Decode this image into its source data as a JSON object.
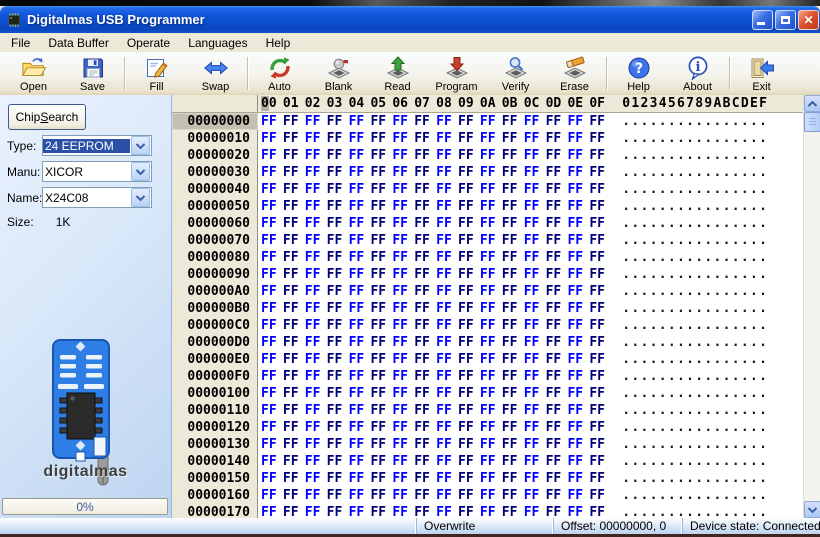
{
  "window": {
    "title": "Digitalmas USB Programmer",
    "controls": {
      "minimize": "minimize",
      "maximize": "maximize",
      "close": "✕"
    }
  },
  "menu_bar": {
    "items": [
      "File",
      "Data Buffer",
      "Operate",
      "Languages",
      "Help"
    ]
  },
  "toolbar": {
    "buttons": [
      {
        "label": "Open",
        "icon": "open-folder-icon",
        "group_end": false
      },
      {
        "label": "Save",
        "icon": "save-floppy-icon",
        "group_end": true
      },
      {
        "label": "Fill",
        "icon": "fill-edit-icon",
        "group_end": false
      },
      {
        "label": "Swap",
        "icon": "swap-arrows-icon",
        "group_end": true
      },
      {
        "label": "Auto",
        "icon": "auto-cycle-icon",
        "group_end": false
      },
      {
        "label": "Blank",
        "icon": "blank-check-icon",
        "group_end": false
      },
      {
        "label": "Read",
        "icon": "read-chip-icon",
        "group_end": false
      },
      {
        "label": "Program",
        "icon": "program-chip-icon",
        "group_end": false
      },
      {
        "label": "Verify",
        "icon": "verify-chip-icon",
        "group_end": false
      },
      {
        "label": "Erase",
        "icon": "erase-chip-icon",
        "group_end": true
      },
      {
        "label": "Help",
        "icon": "help-icon",
        "group_end": false
      },
      {
        "label": "About",
        "icon": "about-icon",
        "group_end": true
      },
      {
        "label": "Exit",
        "icon": "exit-door-icon",
        "group_end": false
      }
    ]
  },
  "sidebar": {
    "chip_search_button": {
      "text": "Chip Search",
      "mnemonic_index": 5
    },
    "fields": [
      {
        "label": "Type:",
        "value": "24 EEPROM",
        "selected": true
      },
      {
        "label": "Manu:",
        "value": "XICOR",
        "selected": false
      },
      {
        "label": "Name:",
        "value": "X24C08",
        "selected": false
      }
    ],
    "size_label": "Size:",
    "size_value": "1K",
    "brand_text": "digitalmas",
    "progress_text": "0%"
  },
  "hex_editor": {
    "column_headers": [
      "00",
      "01",
      "02",
      "03",
      "04",
      "05",
      "06",
      "07",
      "08",
      "09",
      "0A",
      "0B",
      "0C",
      "0D",
      "0E",
      "0F"
    ],
    "ascii_header": "0123456789ABCDEF",
    "row_addresses": [
      "00000000",
      "00000010",
      "00000020",
      "00000030",
      "00000040",
      "00000050",
      "00000060",
      "00000070",
      "00000080",
      "00000090",
      "000000A0",
      "000000B0",
      "000000C0",
      "000000D0",
      "000000E0",
      "000000F0",
      "00000100",
      "00000110",
      "00000120",
      "00000130",
      "00000140",
      "00000150",
      "00000160",
      "00000170"
    ],
    "byte_value": "FF",
    "ascii_text": "................",
    "cursor": {
      "row": 0,
      "header_nibble": 0
    },
    "colors": {
      "byte_even": "#0000FE",
      "byte_odd": "#000078"
    }
  },
  "status_bar": {
    "panels": [
      "Overwrite",
      "Offset: 00000000, 0",
      "Device state: Connected."
    ]
  }
}
